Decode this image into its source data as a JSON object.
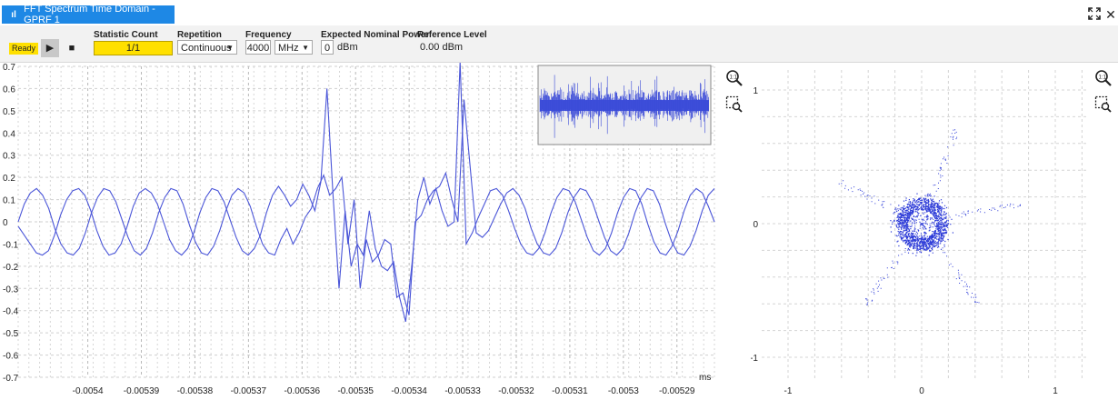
{
  "tab": {
    "title": "FFT Spectrum Time Domain - GPRF 1",
    "icon": "bar-chart-icon"
  },
  "window_controls": {
    "maximize_icon": "maximize-icon",
    "close_glyph": "✕"
  },
  "toolbar": {
    "status": "Ready",
    "statistic_count_label": "Statistic Count",
    "statistic_count_value": "1/1",
    "repetition_label": "Repetition",
    "repetition_value": "Continuous",
    "frequency_label": "Frequency",
    "frequency_value": "4000",
    "frequency_unit": "MHz",
    "expected_power_label": "Expected Nominal Power",
    "expected_power_value": "0",
    "expected_power_unit": "dBm",
    "reference_level_label": "Reference Level",
    "reference_level_value": "0.00 dBm",
    "accent_color": "#ffe000",
    "tab_color": "#1e88e5"
  },
  "chart_data": [
    {
      "type": "line",
      "ylim": [
        -0.7,
        0.7
      ],
      "xlim": [
        -0.005413,
        -0.005283
      ],
      "x_unit": "ms",
      "y_ticks": [
        "0.7",
        "0.6",
        "0.5",
        "0.4",
        "0.3",
        "0.2",
        "0.1",
        "0",
        "-0.1",
        "-0.2",
        "-0.3",
        "-0.4",
        "-0.5",
        "-0.6",
        "-0.7"
      ],
      "x_ticks": [
        "-0.0054",
        "-0.00539",
        "-0.00538",
        "-0.00537",
        "-0.00536",
        "-0.00535",
        "-0.00534",
        "-0.00533",
        "-0.00532",
        "-0.00531",
        "-0.0053",
        "-0.00529"
      ],
      "grid": true,
      "series_color": "#4a55d8",
      "series": [
        {
          "values": [
            -0.02,
            -0.06,
            -0.1,
            -0.14,
            -0.15,
            -0.13,
            -0.06,
            0.03,
            0.1,
            0.14,
            0.15,
            0.12,
            0.05,
            -0.04,
            -0.11,
            -0.15,
            -0.14,
            -0.1,
            -0.02,
            0.07,
            0.13,
            0.15,
            0.13,
            0.08,
            0.0,
            -0.08,
            -0.13,
            -0.15,
            -0.12,
            -0.05,
            0.04,
            0.11,
            0.15,
            0.14,
            0.09,
            0.01,
            -0.07,
            -0.13,
            -0.15,
            -0.12,
            -0.06,
            0.04,
            0.12,
            0.16,
            0.12,
            0.07,
            0.1,
            0.17,
            0.12,
            0.05,
            0.18,
            0.6,
            0.12,
            -0.3,
            0.05,
            -0.2,
            -0.1,
            -0.15,
            0.05,
            -0.12,
            -0.2,
            -0.22,
            -0.18,
            -0.34,
            -0.45,
            -0.2,
            0.1,
            0.2,
            0.08,
            0.15,
            0.05,
            -0.02,
            0.0,
            0.72,
            -0.1,
            -0.05,
            0.02,
            0.08,
            0.14,
            0.15,
            0.12,
            0.05,
            -0.03,
            -0.1,
            -0.14,
            -0.15,
            -0.12,
            -0.05,
            0.04,
            0.11,
            0.15,
            0.14,
            0.09,
            0.01,
            -0.07,
            -0.13,
            -0.15,
            -0.12,
            -0.05,
            0.04,
            0.11,
            0.15,
            0.14,
            0.08,
            -0.01,
            -0.09,
            -0.14,
            -0.15,
            -0.11,
            -0.04,
            0.05,
            0.12,
            0.15,
            0.13,
            0.07,
            0.0
          ]
        },
        {
          "values": [
            0.0,
            0.08,
            0.13,
            0.15,
            0.12,
            0.06,
            -0.03,
            -0.1,
            -0.14,
            -0.15,
            -0.12,
            -0.05,
            0.04,
            0.11,
            0.15,
            0.14,
            0.09,
            0.01,
            -0.07,
            -0.13,
            -0.15,
            -0.12,
            -0.05,
            0.04,
            0.11,
            0.15,
            0.14,
            0.08,
            -0.01,
            -0.09,
            -0.14,
            -0.15,
            -0.11,
            -0.04,
            0.05,
            0.12,
            0.15,
            0.13,
            0.07,
            -0.02,
            -0.1,
            -0.14,
            -0.15,
            -0.08,
            -0.03,
            -0.1,
            -0.05,
            0.02,
            0.06,
            0.15,
            0.21,
            0.12,
            0.15,
            0.2,
            -0.1,
            0.1,
            -0.3,
            -0.08,
            -0.18,
            -0.15,
            -0.08,
            -0.1,
            -0.34,
            -0.32,
            -0.42,
            0.0,
            0.03,
            0.1,
            0.14,
            0.16,
            0.22,
            0.1,
            0.0,
            0.55,
            0.25,
            -0.05,
            -0.07,
            -0.04,
            0.02,
            0.08,
            0.13,
            0.15,
            0.12,
            0.06,
            -0.03,
            -0.1,
            -0.14,
            -0.15,
            -0.12,
            -0.05,
            0.04,
            0.11,
            0.15,
            0.14,
            0.09,
            0.01,
            -0.07,
            -0.13,
            -0.15,
            -0.12,
            -0.05,
            0.04,
            0.11,
            0.15,
            0.14,
            0.08,
            -0.01,
            -0.09,
            -0.14,
            -0.15,
            -0.11,
            -0.04,
            0.05,
            0.12,
            0.15
          ]
        }
      ]
    },
    {
      "type": "scatter",
      "xlim": [
        -1,
        1
      ],
      "ylim": [
        -1,
        1
      ],
      "x_ticks": [
        "-1",
        "0",
        "1"
      ],
      "y_ticks": [
        "1",
        "0",
        "-1"
      ],
      "grid": true,
      "series_color": "#2e3cd8",
      "ring_radius": 0.15,
      "arm_angles_deg": [
        70,
        153,
        12,
        -55,
        -125
      ],
      "arm_radius_range": [
        0.2,
        0.75
      ]
    }
  ],
  "overview": {
    "series_color": "#3a4ad8"
  },
  "icons": {
    "zoom_icon": "zoom-icon",
    "zoom_rect_icon": "zoom-rect-icon"
  }
}
